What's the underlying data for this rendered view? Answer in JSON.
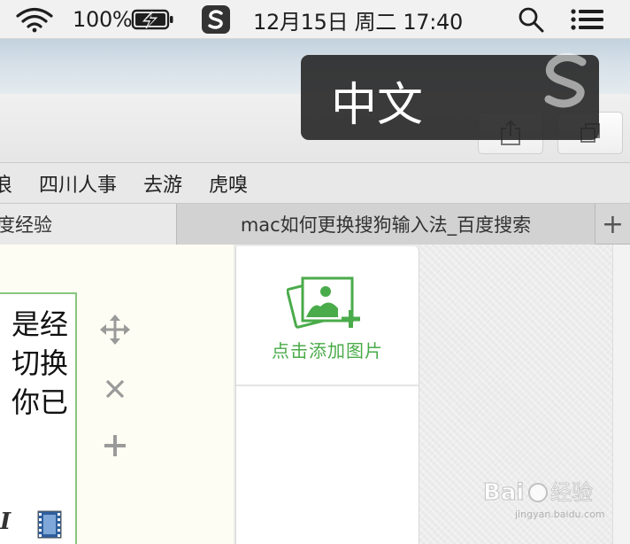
{
  "menubar": {
    "battery_percent": "100%",
    "date_time": "12月15日 周二  17:40",
    "icons": [
      "wifi-icon",
      "battery-charging-icon",
      "sogou-input-icon",
      "search-icon",
      "control-center-icon"
    ]
  },
  "ime_popup": {
    "label": "中文",
    "logo": "sogou-logo"
  },
  "toolbar": {
    "icons": [
      "share-icon",
      "tabs-overview-icon"
    ]
  },
  "bookmarks": [
    "浪",
    "四川人事",
    "去游",
    "虎嗅"
  ],
  "tabs": [
    {
      "label": "度经验",
      "active": true
    },
    {
      "label": "mac如何更换搜狗输入法_百度搜索",
      "active": false
    }
  ],
  "new_tab_label": "+",
  "editor": {
    "lines": [
      "是经",
      "切换",
      "你已"
    ],
    "format_icons": [
      "italic-icon",
      "video-icon"
    ],
    "side_icons": [
      "move-icon",
      "close-icon",
      "add-icon"
    ]
  },
  "image_panel": {
    "add_image_label": "点击添加图片",
    "accent": "#4aab4a"
  },
  "watermark": {
    "text": "Baidu经验",
    "sub": "jingyan.baidu.com"
  }
}
